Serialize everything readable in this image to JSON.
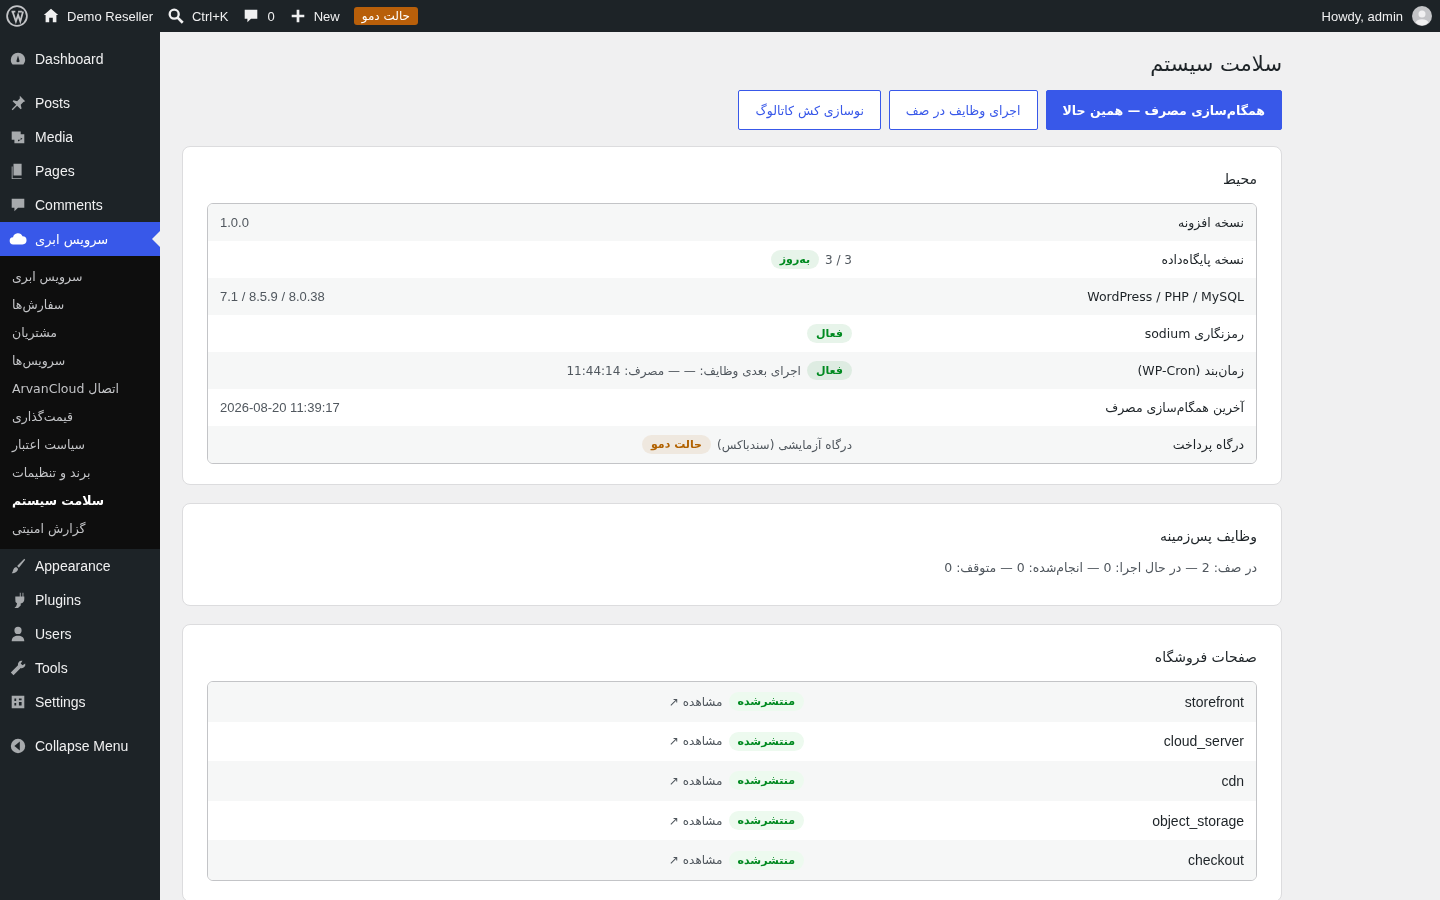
{
  "admin_bar": {
    "site": "Demo Reseller",
    "search": "Ctrl+K",
    "comments": "0",
    "new": "New",
    "demo_badge": "حالت دمو",
    "greeting": "Howdy, admin"
  },
  "menu_groups": [
    [
      {
        "label": "Dashboard",
        "selected": false
      }
    ],
    [
      {
        "label": "Posts",
        "selected": false
      },
      {
        "label": "Media",
        "selected": false
      },
      {
        "label": "Pages",
        "selected": false
      },
      {
        "label": "Comments",
        "selected": false
      },
      {
        "label": "سرویس ابری",
        "selected": true,
        "children": [
          {
            "label": "سرویس ابری",
            "selected": false
          },
          {
            "label": "سفارش‌ها",
            "selected": false
          },
          {
            "label": "مشتریان",
            "selected": false
          },
          {
            "label": "سرویس‌ها",
            "selected": false
          },
          {
            "label": "اتصال ArvanCloud",
            "selected": false
          },
          {
            "label": "قیمت‌گذاری",
            "selected": false
          },
          {
            "label": "سیاست اعتبار",
            "selected": false
          },
          {
            "label": "برند و تنظیمات",
            "selected": false
          },
          {
            "label": "سلامت سیستم",
            "selected": true
          },
          {
            "label": "گزارش امنیتی",
            "selected": false
          }
        ]
      }
    ],
    [
      {
        "label": "Appearance",
        "selected": false
      },
      {
        "label": "Plugins",
        "selected": false
      },
      {
        "label": "Users",
        "selected": false
      },
      {
        "label": "Tools",
        "selected": false
      },
      {
        "label": "Settings",
        "selected": false
      }
    ]
  ],
  "collapse_menu": "Collapse Menu",
  "page_title": "سلامت سیستم",
  "actions": [
    {
      "label": "همگام‌سازی مصرف — همین حالا",
      "kind": "primary"
    },
    {
      "label": "اجرای وظایف در صف",
      "kind": "secondary"
    },
    {
      "label": "نوسازی کش کاتالوگ",
      "kind": "secondary"
    }
  ],
  "environment": {
    "title": "محیط",
    "rows": [
      {
        "label": "نسخه افزونه",
        "parts": [
          {
            "kind": "ltr",
            "text": "1.0.0"
          }
        ]
      },
      {
        "label": "نسخه پایگاه‌داده",
        "parts": [
          {
            "kind": "text",
            "text": "3 / 3"
          },
          {
            "kind": "badge",
            "text": "به‌روز",
            "color": "#008a20"
          }
        ]
      },
      {
        "label": "WordPress / PHP / MySQL",
        "parts": [
          {
            "kind": "ltr",
            "text": "7.1 / 8.5.9 / 8.0.38"
          }
        ]
      },
      {
        "label": "رمزنگاری sodium",
        "parts": [
          {
            "kind": "badge",
            "text": "فعال",
            "color": "#008a20"
          }
        ]
      },
      {
        "label": "زمان‌بند (WP-Cron)",
        "parts": [
          {
            "kind": "badge",
            "text": "فعال",
            "color": "#008a20"
          },
          {
            "kind": "text",
            "text": "اجرای بعدی وظایف: — — مصرف: 11:44:14"
          }
        ]
      },
      {
        "label": "آخرین همگام‌سازی مصرف",
        "parts": [
          {
            "kind": "ltr",
            "text": "2026-08-20 11:39:17"
          }
        ]
      },
      {
        "label": "درگاه پرداخت",
        "parts": [
          {
            "kind": "text",
            "text": "درگاه آزمایشی (سندباکس)"
          },
          {
            "kind": "badge",
            "text": "حالت دمو",
            "color": "#b26200"
          }
        ]
      }
    ]
  },
  "background_jobs": {
    "title": "وظایف پس‌زمینه",
    "summary": "در صف: 2 — در حال اجرا: 0 — انجام‌شده: 0 — متوقف: 0"
  },
  "store_pages": {
    "title": "صفحات فروشگاه",
    "rows": [
      {
        "label": "storefront",
        "status": "منتشرشده",
        "link": "مشاهده ↗"
      },
      {
        "label": "cloud_server",
        "status": "منتشرشده",
        "link": "مشاهده ↗"
      },
      {
        "label": "cdn",
        "status": "منتشرشده",
        "link": "مشاهده ↗"
      },
      {
        "label": "object_storage",
        "status": "منتشرشده",
        "link": "مشاهده ↗"
      },
      {
        "label": "checkout",
        "status": "منتشرشده",
        "link": "مشاهده ↗"
      }
    ]
  }
}
